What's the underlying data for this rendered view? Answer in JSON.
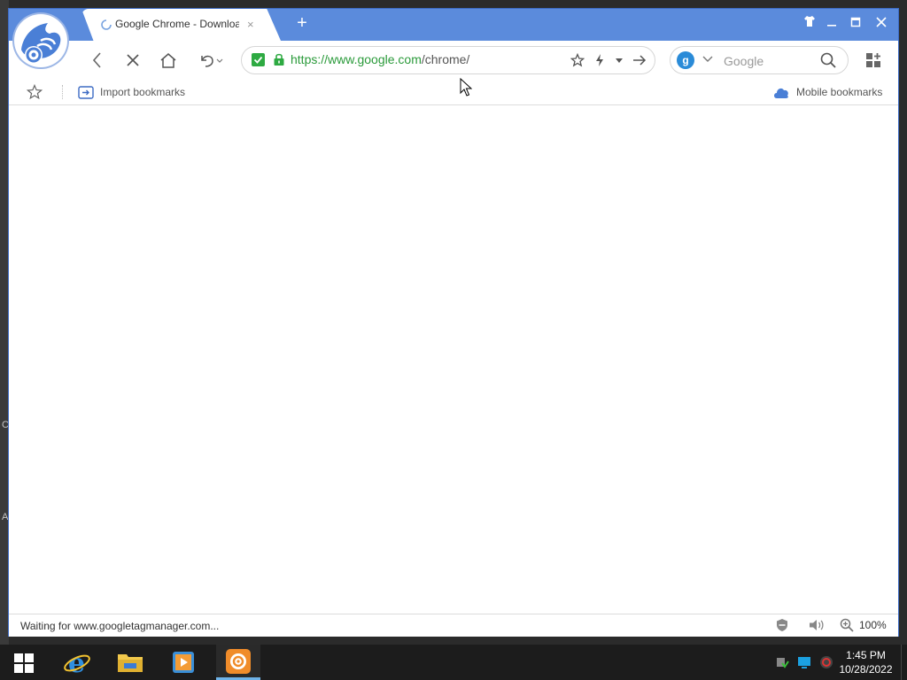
{
  "desktop": {
    "glyphs": [
      "C",
      "A"
    ]
  },
  "tab": {
    "title": "Google Chrome - Download",
    "close": "×"
  },
  "new_tab": "+",
  "window_controls": {
    "skin": "skin-icon",
    "minimize": "–",
    "maximize": "□",
    "close": "×"
  },
  "address_bar": {
    "scheme": "https://",
    "host": "www.google.com",
    "path": "/chrome/"
  },
  "search": {
    "engine_letter": "g",
    "placeholder": "Google"
  },
  "bookmarks": {
    "import_label": "Import bookmarks",
    "mobile_label": "Mobile bookmarks"
  },
  "status": {
    "text": "Waiting for www.googletagmanager.com...",
    "zoom": "100%"
  },
  "clock": {
    "time": "1:45 PM",
    "date": "10/28/2022"
  },
  "colors": {
    "titlebar": "#5b8bdc",
    "secure": "#2eaa42",
    "url_green": "#2a9a3a",
    "accent": "#2a8bd8"
  }
}
